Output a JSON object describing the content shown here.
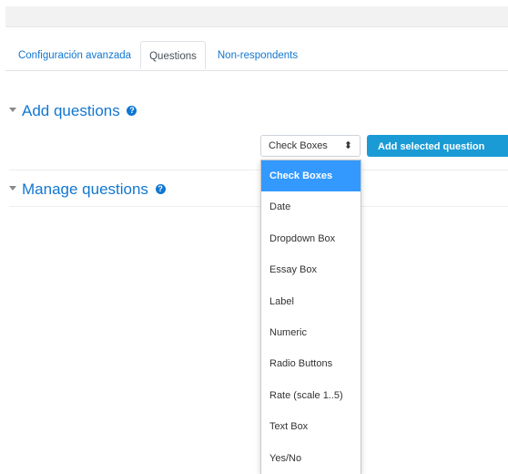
{
  "tabs": [
    {
      "label": "Configuración avanzada",
      "active": false
    },
    {
      "label": "Questions",
      "active": true
    },
    {
      "label": "Non-respondents",
      "active": false
    }
  ],
  "add_section": {
    "title": "Add questions",
    "help_icon": "question-circle-icon"
  },
  "manage_section": {
    "title": "Manage questions",
    "help_icon": "question-circle-icon"
  },
  "question_type_select": {
    "value": "Check Boxes"
  },
  "add_button": {
    "label": "Add selected question type"
  },
  "dropdown_options": [
    "Check Boxes",
    "Date",
    "Dropdown Box",
    "Essay Box",
    "Label",
    "Numeric",
    "Radio Buttons",
    "Rate (scale 1..5)",
    "Text Box",
    "Yes/No"
  ],
  "colors": {
    "link": "#1177d1",
    "button": "#1a9bd6",
    "option_selected": "#3399ff"
  }
}
